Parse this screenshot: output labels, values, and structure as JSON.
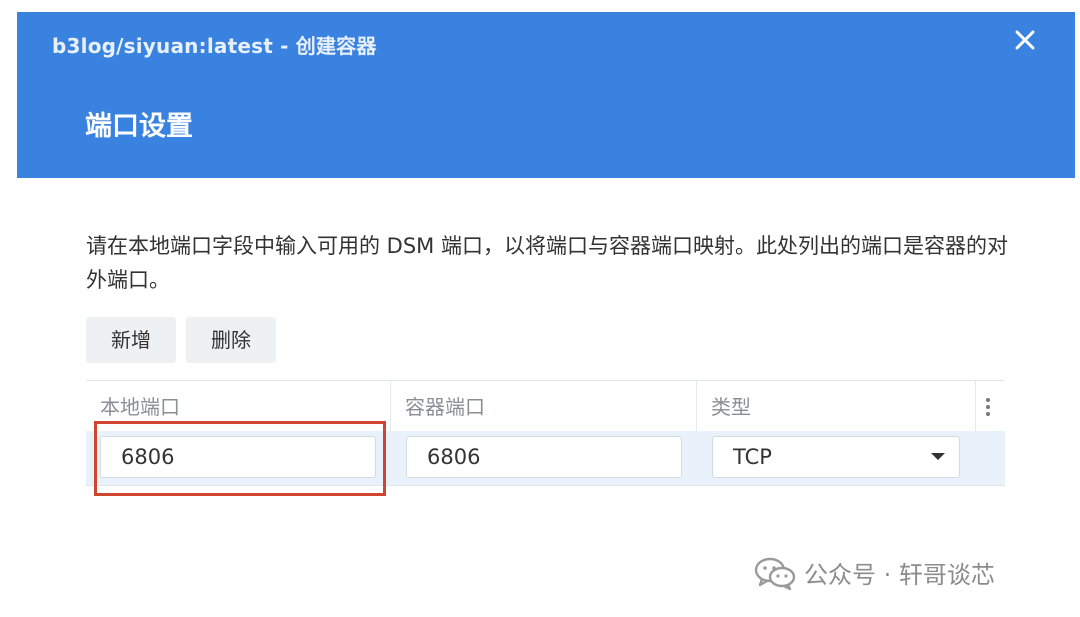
{
  "window": {
    "title": "b3log/siyuan:latest - 创建容器",
    "close_icon": "close-icon"
  },
  "section": {
    "title": "端口设置"
  },
  "description": "请在本地端口字段中输入可用的 DSM 端口，以将端口与容器端口映射。此处列出的端口是容器的对外端口。",
  "toolbar": {
    "add_label": "新增",
    "delete_label": "删除"
  },
  "table": {
    "columns": [
      "本地端口",
      "容器端口",
      "类型"
    ],
    "more_icon": "more-vertical-icon",
    "rows": [
      {
        "local_port": "6806",
        "container_port": "6806",
        "type": "TCP"
      }
    ]
  },
  "highlight": {
    "color": "#d0452f"
  },
  "watermark": {
    "icon": "wechat-icon",
    "text": "公众号 · 轩哥谈芯"
  },
  "colors": {
    "header_bg": "#3a82e0",
    "row_selected_bg": "#e9f1fb"
  }
}
